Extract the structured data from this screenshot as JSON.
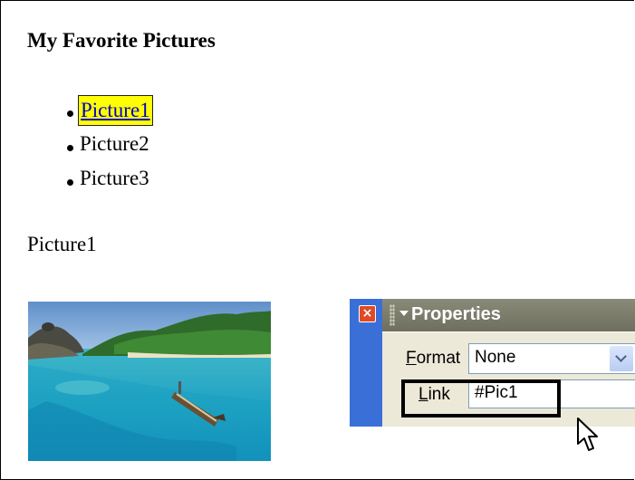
{
  "document": {
    "title": "My Favorite Pictures",
    "list_items": [
      {
        "label": "Picture1",
        "state": "selected-link"
      },
      {
        "label": "Picture2"
      },
      {
        "label": "Picture3"
      }
    ],
    "section_heading": "Picture1"
  },
  "properties_panel": {
    "title": "Properties",
    "close_icon": "close-icon",
    "format_label_accel": "F",
    "format_label_rest": "ormat",
    "format_value": "None",
    "link_label_accel": "L",
    "link_label_rest": "ink",
    "link_value": "#Pic1"
  },
  "colors": {
    "selection_highlight": "#ffff00",
    "link_text": "#0000cc",
    "panel_frame": "#3a6fd8",
    "panel_title_bar": "#7a7a6a",
    "panel_body": "#ece9d8",
    "close_button": "#e04a28"
  }
}
